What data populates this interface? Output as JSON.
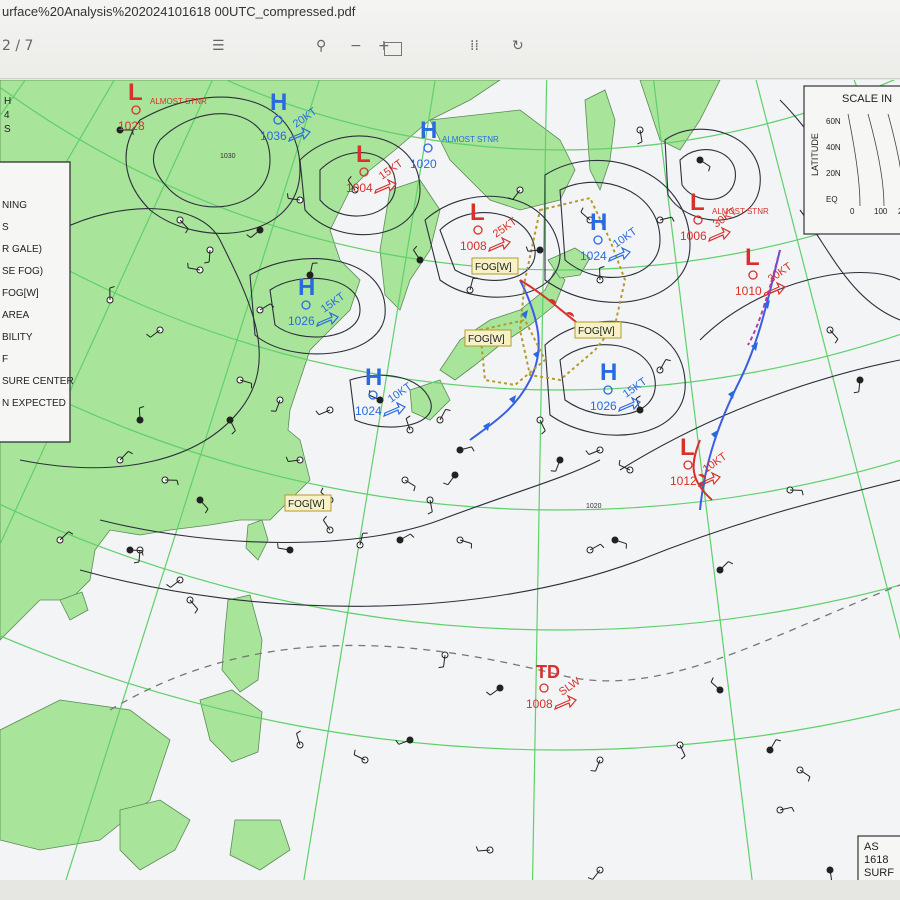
{
  "viewer": {
    "filename": "urface%20Analysis%202024101618 00UTC_compressed.pdf",
    "page_indicator": "2 / 7",
    "tool_icons": [
      "page-nav-icon",
      "search-icon",
      "zoom-out-icon",
      "zoom-in-icon",
      "fit-page-icon",
      "page-view-icon",
      "rotate-icon"
    ]
  },
  "legend": {
    "items": [
      "NING",
      "S",
      "R GALE)",
      "SE FOG)",
      "FOG[W]",
      "AREA",
      "BILITY",
      "F",
      "SURE CENTER",
      "N EXPECTED"
    ],
    "corner_fragments": [
      "H",
      "4",
      "S"
    ]
  },
  "scale_box": {
    "title": "SCALE IN",
    "axis_label": "LATITUDE",
    "ticks": [
      "60N",
      "40N",
      "20N",
      "EQ"
    ],
    "x_ticks": [
      "0",
      "100",
      "20"
    ]
  },
  "footer_box": {
    "lines": [
      "AS",
      "1618",
      "SURF"
    ]
  },
  "pressure_centers": [
    {
      "type": "L",
      "value": "1028",
      "note": "ALMOST STNR"
    },
    {
      "type": "H",
      "value": "1036",
      "speed": "20KT"
    },
    {
      "type": "L",
      "value": "1004",
      "speed": "15KT"
    },
    {
      "type": "H",
      "value": "1020",
      "note": "ALMOST STNR"
    },
    {
      "type": "L",
      "value": "1008",
      "speed": "25KT"
    },
    {
      "type": "H",
      "value": "1024",
      "speed": "10KT"
    },
    {
      "type": "L",
      "value": "1006",
      "note": "ALMOST STNR",
      "speed": "30KT"
    },
    {
      "type": "L",
      "value": "1010",
      "speed": "30KT"
    },
    {
      "type": "H",
      "value": "1026",
      "speed": "15KT"
    },
    {
      "type": "H",
      "value": "1026",
      "speed": "15KT"
    },
    {
      "type": "H",
      "value": "1024",
      "speed": "10KT"
    },
    {
      "type": "L",
      "value": "1012",
      "speed": "10KT"
    },
    {
      "type": "TD",
      "value": "1008",
      "speed": "SLW"
    }
  ],
  "fog_labels": [
    "FOG[W]",
    "FOG[W]",
    "FOG[W]",
    "FOG[W]"
  ],
  "isobar_labels": [
    "1030",
    "1020"
  ],
  "colors": {
    "land": "#a8e49a",
    "sea": "#f3f4f6",
    "grid": "#5fd06a",
    "isobar": "#2b2f3a",
    "high": "#2a6ae0",
    "low": "#d8302b",
    "fog_area": "#b59a2a"
  }
}
